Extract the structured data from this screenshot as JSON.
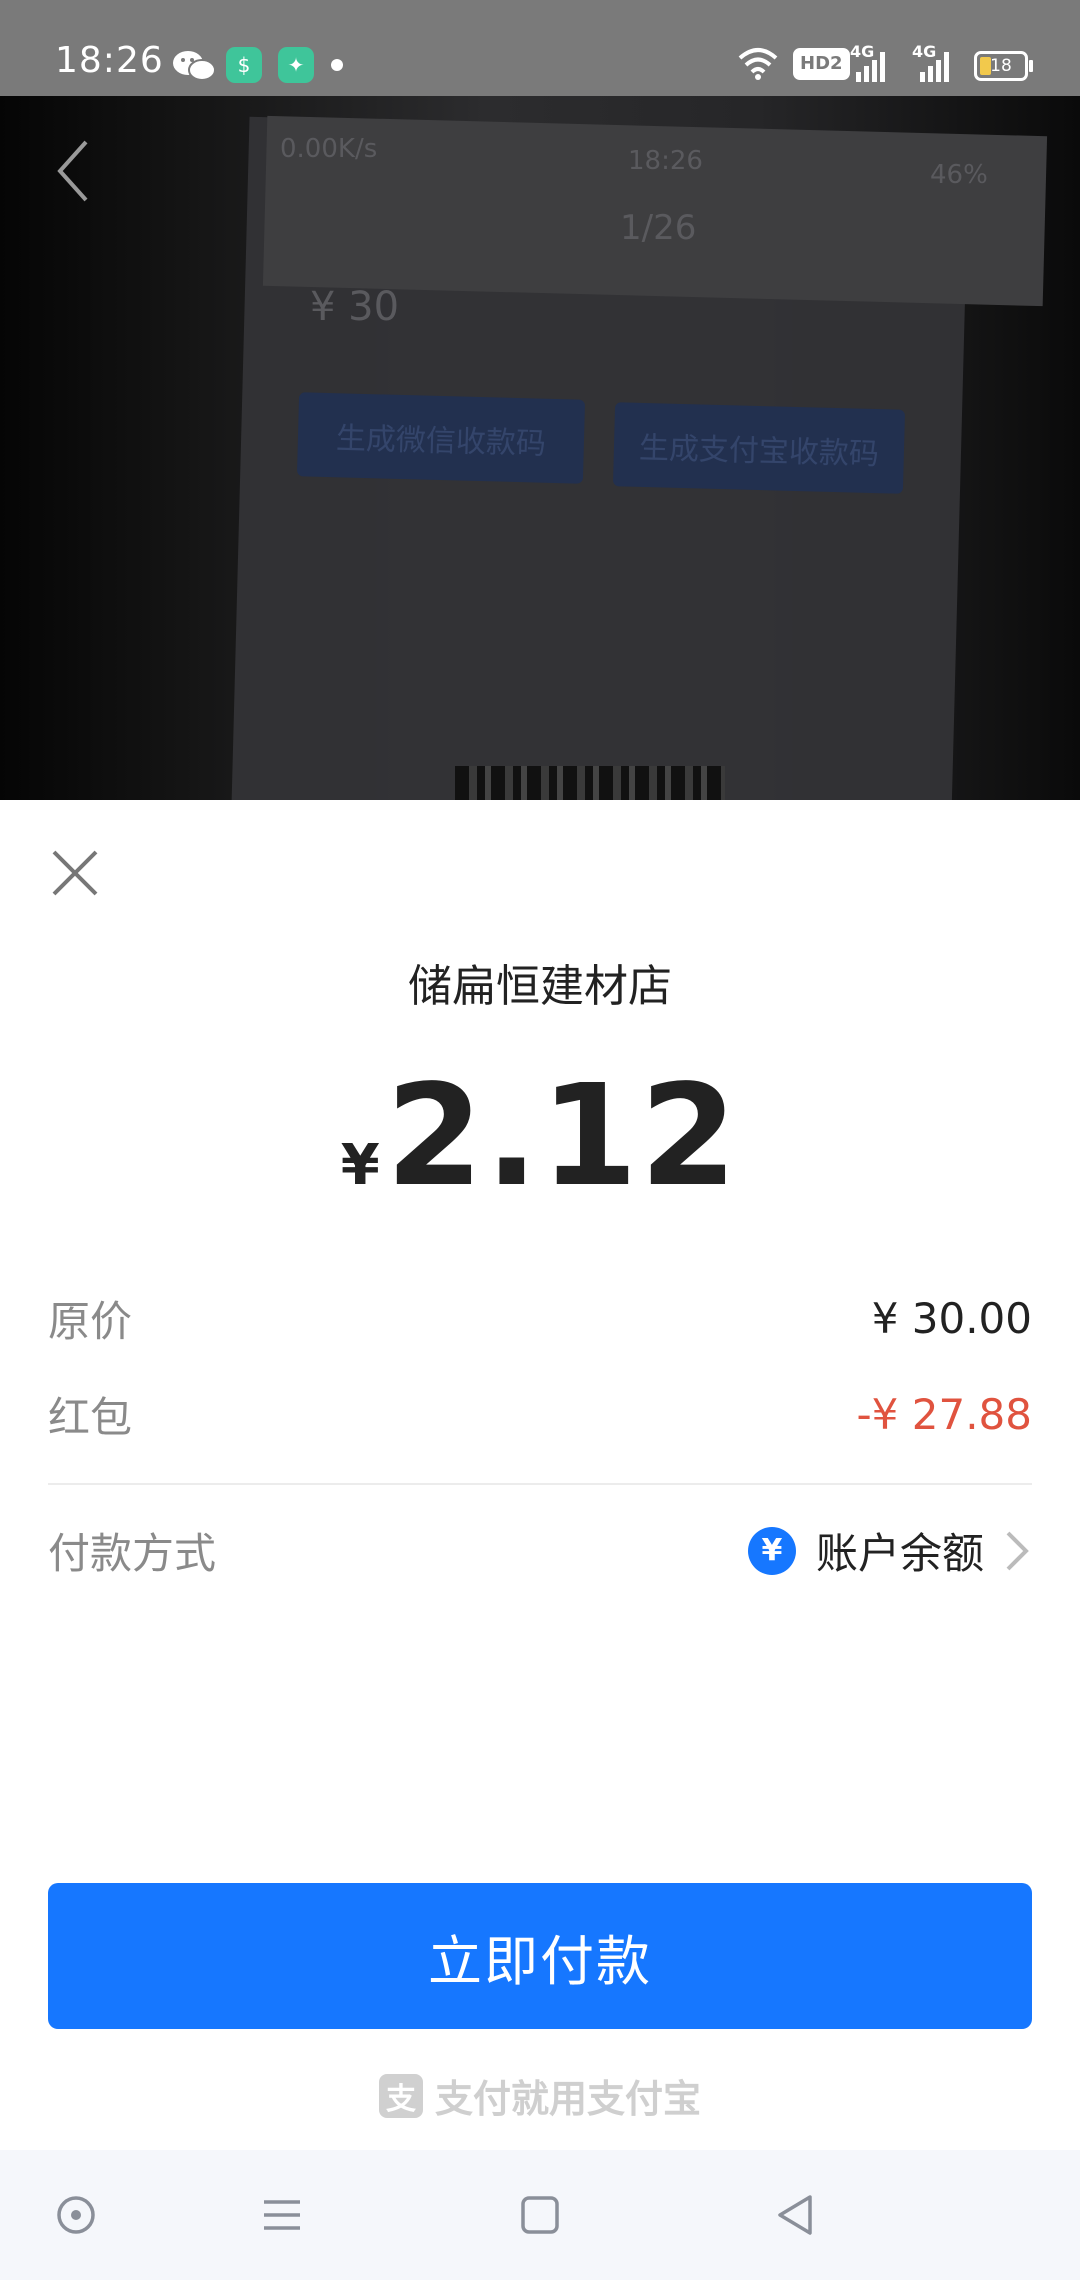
{
  "status_bar": {
    "time": "18:26",
    "icons": [
      "wechat-icon",
      "security-app-icon",
      "game-app-icon",
      "dot-icon",
      "wifi-icon",
      "hd-icon",
      "signal-4g-icon",
      "signal-4g-icon",
      "battery-icon"
    ],
    "hd_label": "HD2",
    "network_label_1": "4G",
    "network_label_2": "4G",
    "battery_level": "18",
    "battery_color": "#f2c94c"
  },
  "camera_view": {
    "background_text": {
      "speed": "0.00K/s",
      "time": "18:26",
      "battery": "46%",
      "counter": "1/26",
      "amount": "¥ 30",
      "wechat_button": "生成微信收款码",
      "alipay_button": "生成支付宝收款码"
    }
  },
  "sheet": {
    "merchant_name": "储扁恒建材店",
    "currency_symbol": "¥",
    "amount": "2.12",
    "original_price_label": "原价",
    "original_price_value": "¥ 30.00",
    "red_packet_label": "红包",
    "red_packet_value": "-¥ 27.88",
    "payment_method_label": "付款方式",
    "payment_method_icon": "¥",
    "payment_method_value": "账户余额",
    "pay_button_label": "立即付款",
    "brand_logo": "支",
    "brand_slogan": "支付就用支付宝"
  },
  "colors": {
    "accent": "#1677ff",
    "discount": "#e0533f"
  },
  "nav_bar": {
    "buttons": [
      "assistant-icon",
      "menu-icon",
      "home-icon",
      "back-icon"
    ]
  }
}
